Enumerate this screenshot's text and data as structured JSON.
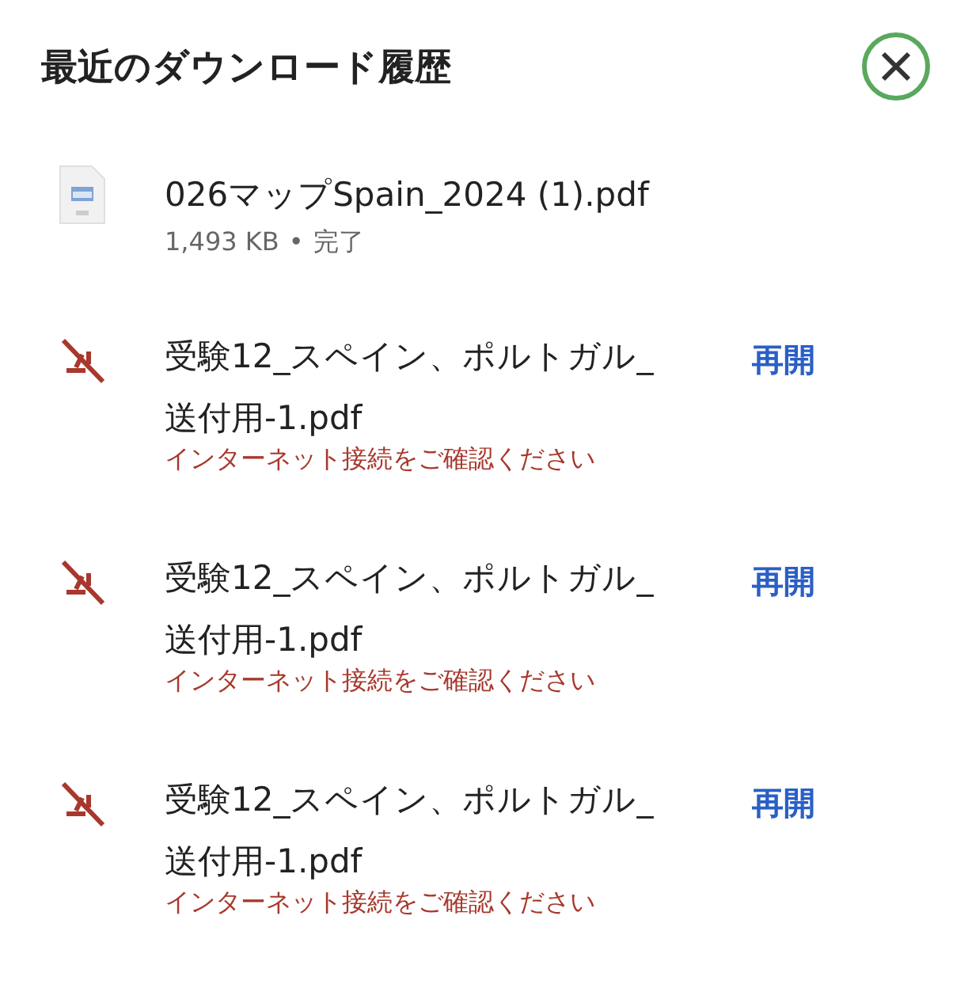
{
  "title": "最近のダウンロード履歴",
  "items": [
    {
      "kind": "done",
      "name": "026マップSpain_2024 (1).pdf",
      "size": "1,493 KB",
      "separator": "•",
      "status": "完了"
    },
    {
      "kind": "failed",
      "name": "受験12_スペイン、ポルトガル_送付用-1.pdf",
      "status": "インターネット接続をご確認ください",
      "action": "再開"
    },
    {
      "kind": "failed",
      "name": "受験12_スペイン、ポルトガル_送付用-1.pdf",
      "status": "インターネット接続をご確認ください",
      "action": "再開"
    },
    {
      "kind": "failed",
      "name": "受験12_スペイン、ポルトガル_送付用-1.pdf",
      "status": "インターネット接続をご確認ください",
      "action": "再開"
    }
  ]
}
